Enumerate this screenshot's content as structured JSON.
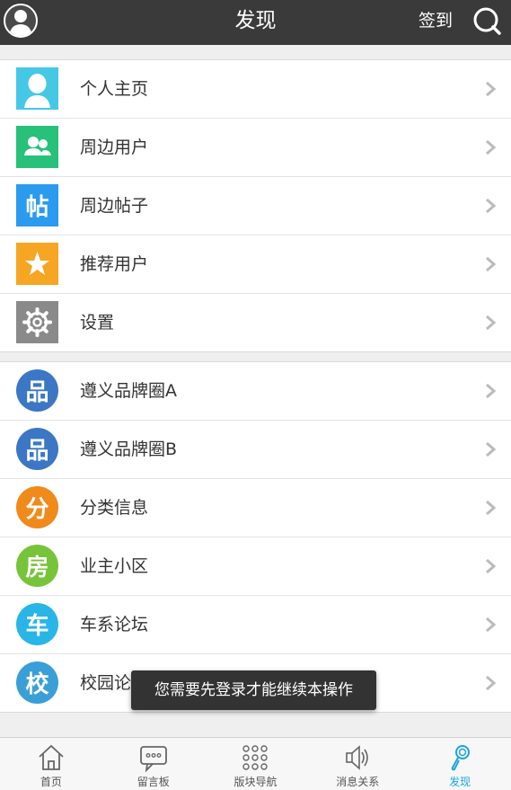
{
  "header": {
    "title": "发现",
    "signin_label": "签到",
    "avatar_icon": "user-avatar-icon",
    "search_icon": "search-icon"
  },
  "group1": [
    {
      "label": "个人主页",
      "icon": "person-icon",
      "color": "#45c8e6"
    },
    {
      "label": "周边用户",
      "icon": "users-icon",
      "color": "#27c17a"
    },
    {
      "label": "周边帖子",
      "icon_text": "帖",
      "color": "#2a9bef"
    },
    {
      "label": "推荐用户",
      "icon": "star-icon",
      "color": "#f6a623"
    },
    {
      "label": "设置",
      "icon": "gear-icon",
      "color": "#8a8a8a"
    }
  ],
  "group2": [
    {
      "label": "遵义品牌圈A",
      "icon_text": "品",
      "color": "#3b77c4"
    },
    {
      "label": "遵义品牌圈B",
      "icon_text": "品",
      "color": "#3b77c4"
    },
    {
      "label": "分类信息",
      "icon_text": "分",
      "color": "#ef8a1b"
    },
    {
      "label": "业主小区",
      "icon_text": "房",
      "color": "#77c43a"
    },
    {
      "label": "车系论坛",
      "icon_text": "车",
      "color": "#29b5e7"
    },
    {
      "label": "校园论坛",
      "icon_text": "校",
      "color": "#3a9fd6"
    }
  ],
  "toast": {
    "text": "您需要先登录才能继续本操作"
  },
  "tabbar": [
    {
      "label": "首页",
      "icon": "home-icon",
      "active": false
    },
    {
      "label": "留言板",
      "icon": "message-board-icon",
      "active": false
    },
    {
      "label": "版块导航",
      "icon": "grid-icon",
      "active": false
    },
    {
      "label": "消息关系",
      "icon": "speaker-icon",
      "active": false
    },
    {
      "label": "发现",
      "icon": "discover-icon",
      "active": true
    }
  ],
  "colors": {
    "accent": "#1aa5e0",
    "header_bg": "#3a3a3a"
  }
}
